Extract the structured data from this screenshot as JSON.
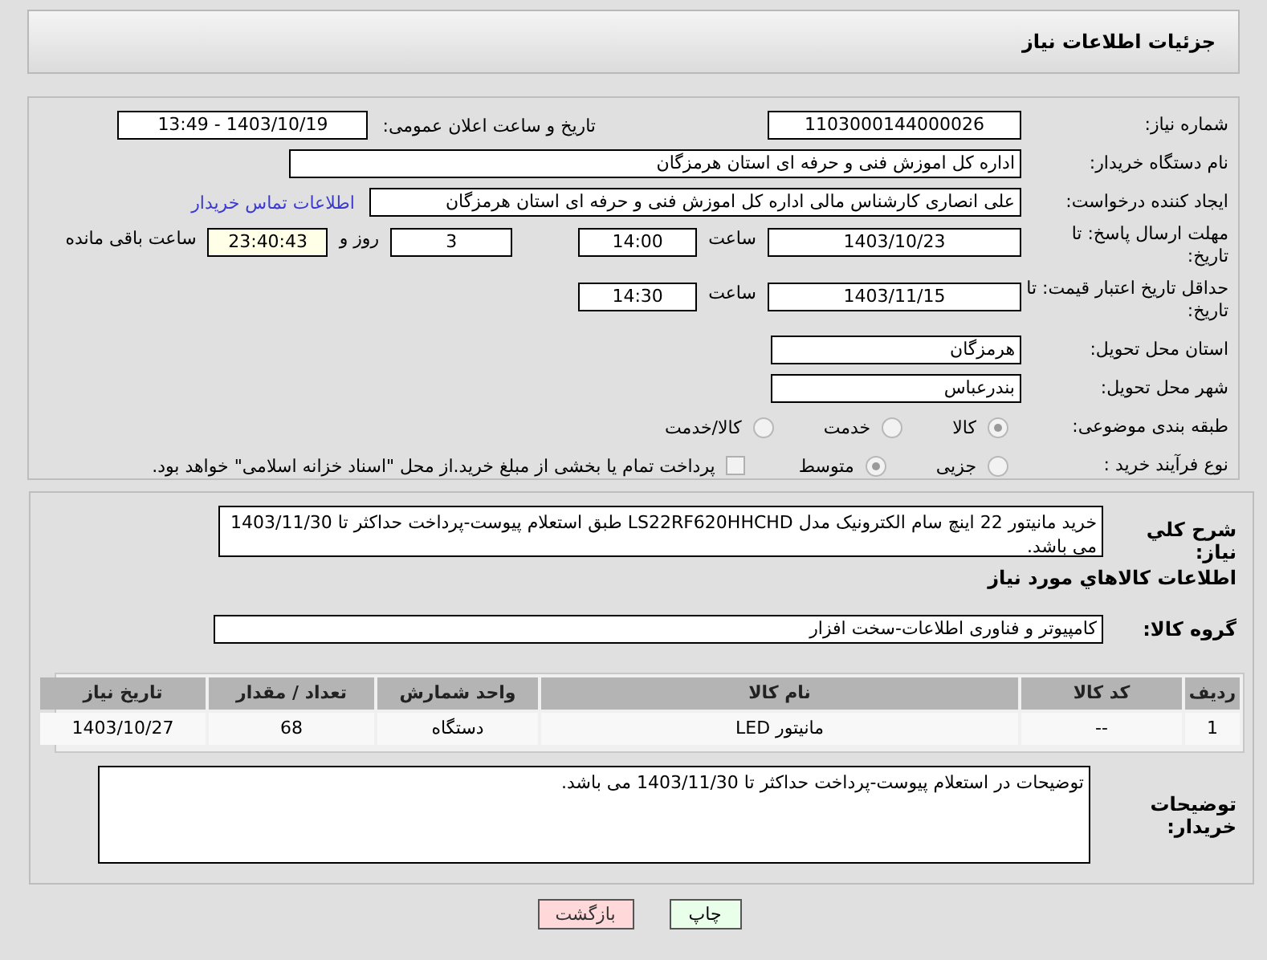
{
  "header": {
    "title": "جزئیات اطلاعات نیاز"
  },
  "details": {
    "need_number": {
      "label": "شماره نیاز:",
      "value": "1103000144000026"
    },
    "announce": {
      "label": "تاریخ و ساعت اعلان عمومی:",
      "value": "1403/10/19 - 13:49"
    },
    "buyer": {
      "label": "نام دستگاه خریدار:",
      "value": "اداره کل اموزش فنی و حرفه ای استان هرمزگان"
    },
    "requester": {
      "label": "ایجاد کننده درخواست:",
      "value": "علی انصاری کارشناس مالی اداره کل اموزش فنی و حرفه ای استان هرمزگان",
      "link": "اطلاعات تماس خریدار"
    },
    "deadline": {
      "label": "مهلت ارسال پاسخ: تا تاریخ:",
      "date": "1403/10/23",
      "time_label": "ساعت",
      "time": "14:00",
      "days": "3",
      "days_label": "روز و",
      "remaining": "23:40:43",
      "remaining_label": "ساعت باقی مانده"
    },
    "validity": {
      "label": "حداقل تاریخ اعتبار قیمت: تا تاریخ:",
      "date": "1403/11/15",
      "time_label": "ساعت",
      "time": "14:30"
    },
    "province": {
      "label": "استان محل تحویل:",
      "value": "هرمزگان"
    },
    "city": {
      "label": "شهر محل تحویل:",
      "value": "بندرعباس"
    },
    "category": {
      "label": "طبقه بندی موضوعی:",
      "options": [
        {
          "label": "کالا",
          "selected": true
        },
        {
          "label": "خدمت",
          "selected": false
        },
        {
          "label": "کالا/خدمت",
          "selected": false
        }
      ]
    },
    "process": {
      "label": "نوع فرآیند خرید :",
      "options": [
        {
          "label": "جزیی",
          "selected": false
        },
        {
          "label": "متوسط",
          "selected": true
        }
      ],
      "treasury": {
        "label": "پرداخت تمام یا بخشی از مبلغ خرید.از محل \"اسناد خزانه اسلامی\" خواهد بود.",
        "checked": false
      }
    }
  },
  "needs": {
    "description_label": "شرح کلي نیاز:",
    "description": "خرید مانیتور 22 اینچ سام الکترونیک مدل LS22RF620HHCHD طبق استعلام پیوست-پرداخت حداکثر تا 1403/11/30 می باشد.",
    "goods_heading": "اطلاعات کالاهاي مورد نیاز",
    "group_label": "گروه کالا:",
    "group": "کامپیوتر و فناوری اطلاعات-سخت افزار",
    "table": {
      "columns": [
        "ردیف",
        "کد کالا",
        "نام کالا",
        "واحد شمارش",
        "تعداد / مقدار",
        "تاریخ نیاز"
      ],
      "rows": [
        [
          "1",
          "--",
          "مانیتور LED",
          "دستگاه",
          "68",
          "1403/10/27"
        ]
      ]
    },
    "notes_label": "توضیحات خریدار:",
    "notes": "توضیحات در استعلام پیوست-پرداخت حداکثر تا 1403/11/30 می باشد."
  },
  "buttons": [
    {
      "label": "چاپ",
      "kind": "print"
    },
    {
      "label": "بازگشت",
      "kind": "back"
    }
  ]
}
